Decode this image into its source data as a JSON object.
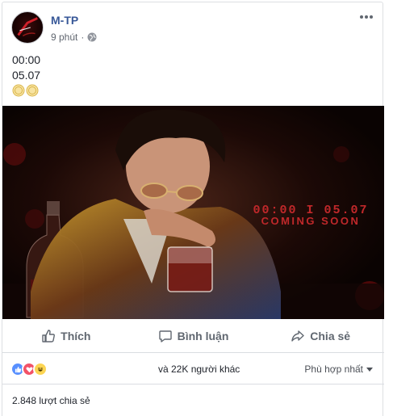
{
  "post": {
    "author": "M-TP",
    "time": "9 phút",
    "privacy_icon": "globe-icon",
    "text_lines": [
      "00:00",
      "05.07"
    ],
    "emoji": [
      "coin-emoji",
      "coin-emoji"
    ]
  },
  "media": {
    "overlay_line1": "00:00 I 05.07",
    "overlay_line2": "COMING SOON"
  },
  "actions": {
    "like": "Thích",
    "comment": "Bình luận",
    "share": "Chia sẻ"
  },
  "reactions": {
    "icons": [
      "like-icon",
      "love-icon",
      "haha-icon"
    ],
    "others": "và 22K người khác",
    "sort": "Phù hợp nhất"
  },
  "shares": "2.848 lượt chia sẻ",
  "colors": {
    "author": "#385898",
    "like": "#5890ff",
    "love": "#f25268",
    "haha": "#fcd553",
    "overlay_red": "#c0282a"
  }
}
